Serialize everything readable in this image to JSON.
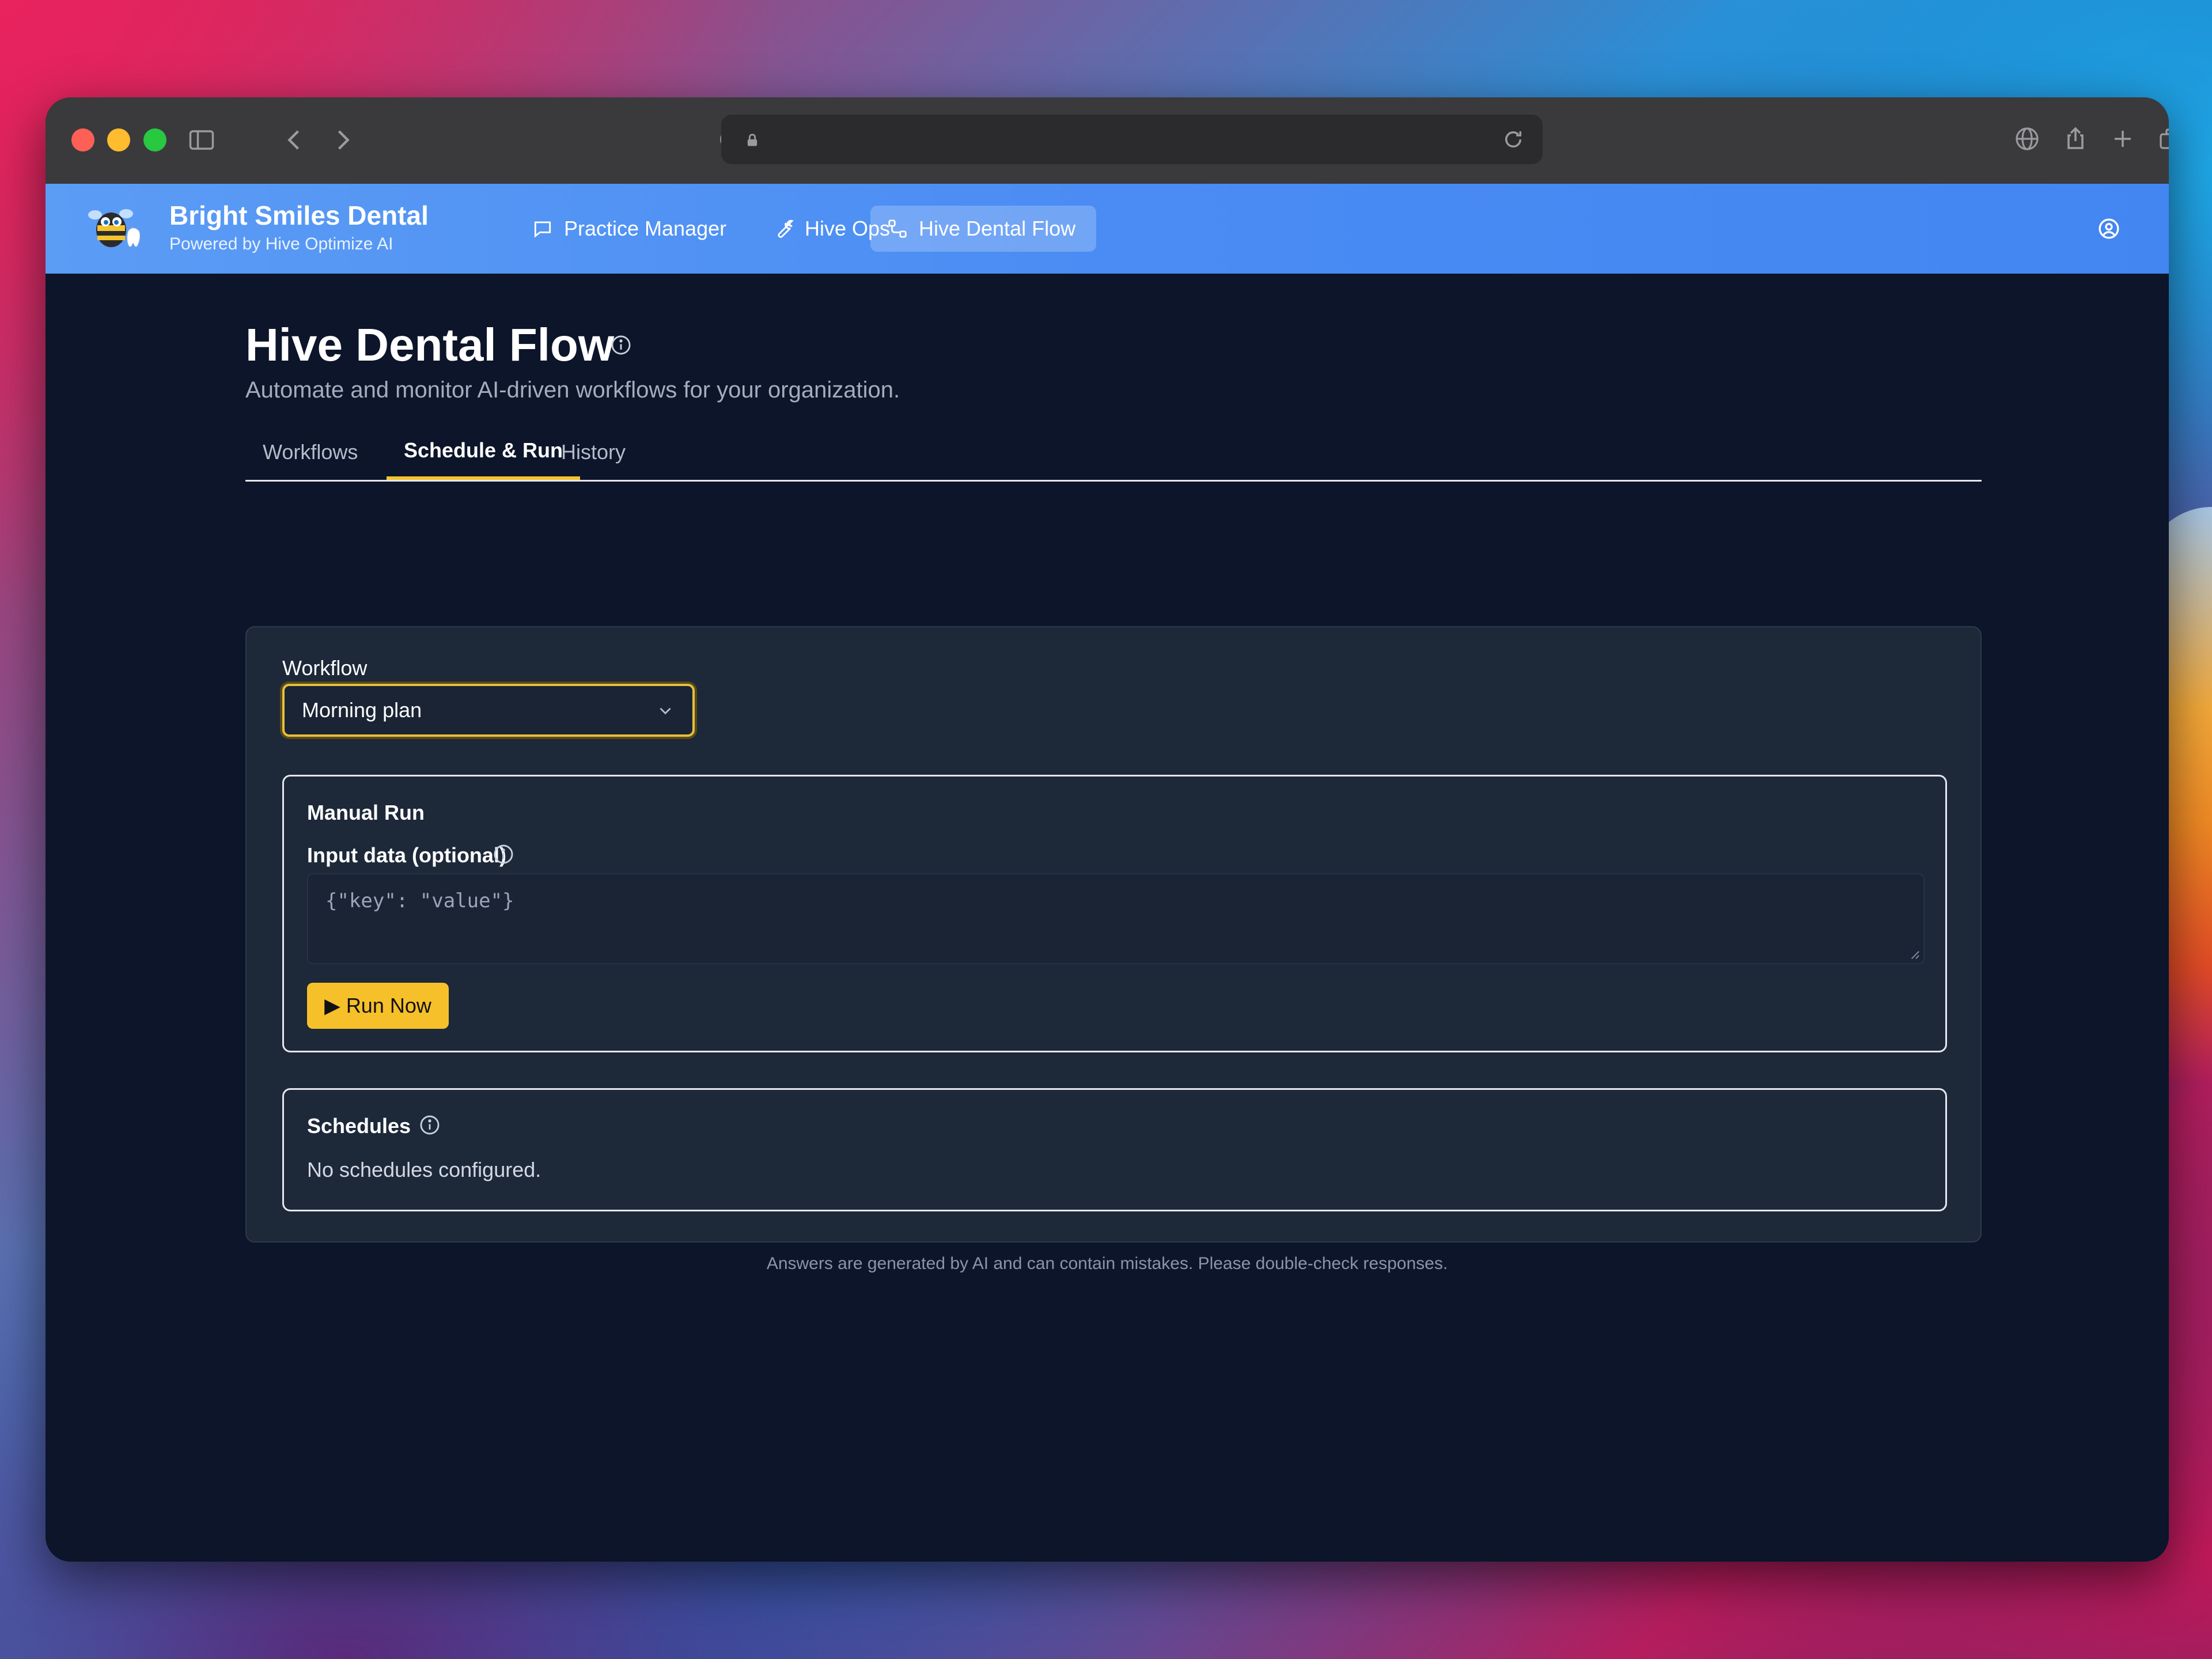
{
  "app": {
    "brand_title": "Bright Smiles Dental",
    "brand_subtitle": "Powered by Hive Optimize AI",
    "nav": [
      {
        "label": "Practice Manager",
        "icon": "chat-bubble-icon"
      },
      {
        "label": "Hive Ops",
        "icon": "wrench-icon"
      },
      {
        "label": "Hive Dental Flow",
        "icon": "workflow-icon",
        "active": true
      }
    ],
    "user_icon": "user-circle-icon"
  },
  "page": {
    "title": "Hive Dental Flow",
    "subtitle": "Automate and monitor AI-driven workflows for your organization.",
    "tabs": [
      {
        "label": "Workflows",
        "active": false
      },
      {
        "label": "Schedule & Run",
        "active": true
      },
      {
        "label": "History",
        "active": false
      }
    ]
  },
  "workflow": {
    "label": "Workflow",
    "selected": "Morning plan"
  },
  "manual_run": {
    "title": "Manual Run",
    "input_label": "Input data (optional)",
    "input_placeholder": "{\"key\": \"value\"}",
    "run_button": "▶ Run Now"
  },
  "schedules": {
    "title": "Schedules",
    "empty_text": "No schedules configured."
  },
  "footer": {
    "note": "Answers are generated by AI and can contain mistakes. Please double-check responses."
  },
  "colors": {
    "accent_yellow": "#f6c02b",
    "header_blue": "#4a8cf3",
    "page_bg": "#0c1529",
    "panel_bg": "#1d2839"
  }
}
